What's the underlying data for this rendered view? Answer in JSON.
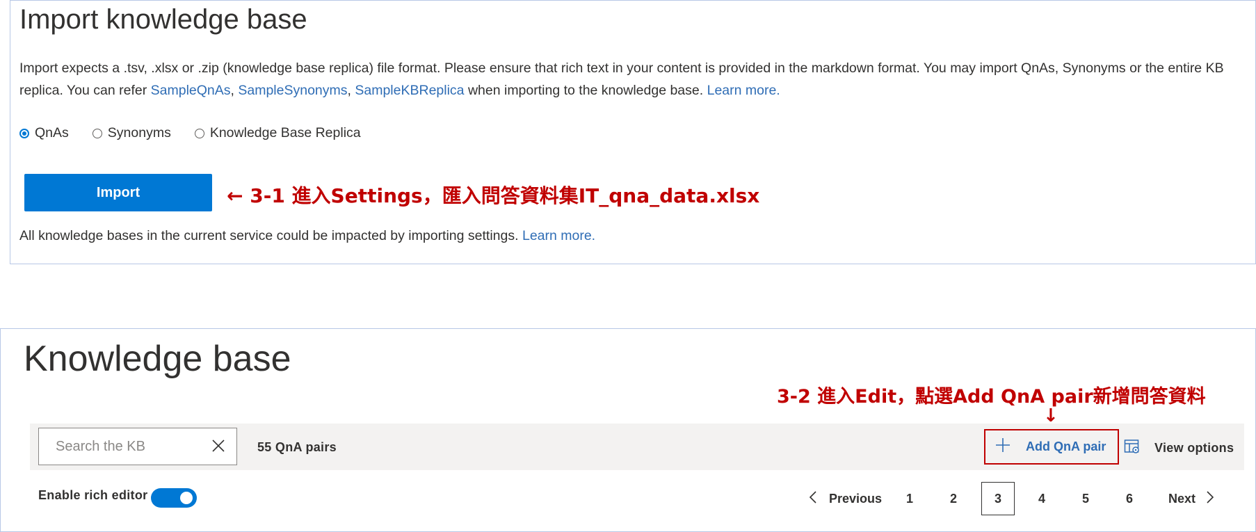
{
  "import_panel": {
    "title": "Import knowledge base",
    "desc_part1": "Import expects a .tsv, .xlsx or .zip (knowledge base replica) file format. Please ensure that rich text in your content is provided in the markdown format. You may import QnAs, Synonyms or the entire KB replica. You can refer ",
    "link_sample_qnas": "SampleQnAs",
    "sep1": ", ",
    "link_sample_synonyms": "SampleSynonyms",
    "sep2": ", ",
    "link_sample_replica": "SampleKBReplica",
    "desc_part2": " when importing to the knowledge base. ",
    "learn_more": "Learn more.",
    "radios": [
      {
        "label": "QnAs",
        "checked": true
      },
      {
        "label": "Synonyms",
        "checked": false
      },
      {
        "label": "Knowledge Base Replica",
        "checked": false
      }
    ],
    "import_button": "Import",
    "annotation": "← 3-1 進入Settings，匯入問答資料集IT_qna_data.xlsx",
    "note": "All knowledge bases in the current service could be impacted by importing settings. ",
    "note_learn_more": "Learn more."
  },
  "kb_panel": {
    "title": "Knowledge base",
    "annotation": "3-2 進入Edit，點選Add QnA pair新增問答資料",
    "arrow": "↓",
    "search_placeholder": "Search the KB",
    "pairs_count": "55 QnA pairs",
    "add_pair": "Add QnA pair",
    "view_options": "View options",
    "rich_editor_label": "Enable rich editor",
    "rich_editor_enabled": true,
    "pager": {
      "previous": "Previous",
      "pages": [
        "1",
        "2",
        "3",
        "4",
        "5",
        "6"
      ],
      "current": "3",
      "next": "Next"
    }
  },
  "colors": {
    "accent": "#0078d4",
    "link": "#2f6db5",
    "annotation": "#c00000"
  },
  "icons": [
    "close-icon",
    "plus-icon",
    "view-options-icon",
    "chevron-left-icon",
    "chevron-right-icon"
  ]
}
